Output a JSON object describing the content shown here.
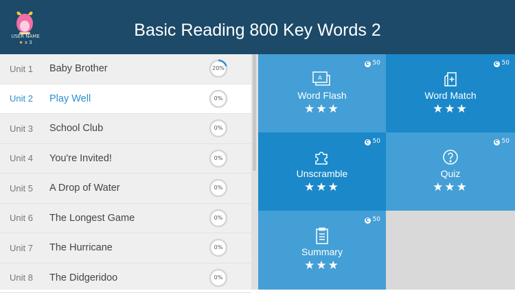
{
  "header": {
    "title": "Basic Reading 800 Key Words 2",
    "user_name": "USER NAME",
    "star_count": "x 3"
  },
  "units": [
    {
      "unit": "Unit 1",
      "name": "Baby Brother",
      "progress": "20%",
      "pct": 20
    },
    {
      "unit": "Unit 2",
      "name": "Play Well",
      "progress": "0%",
      "pct": 0,
      "selected": true
    },
    {
      "unit": "Unit 3",
      "name": "School Club",
      "progress": "0%",
      "pct": 0
    },
    {
      "unit": "Unit 4",
      "name": "You're Invited!",
      "progress": "0%",
      "pct": 0
    },
    {
      "unit": "Unit 5",
      "name": "A Drop of Water",
      "progress": "0%",
      "pct": 0
    },
    {
      "unit": "Unit 6",
      "name": "The Longest Game",
      "progress": "0%",
      "pct": 0
    },
    {
      "unit": "Unit 7",
      "name": "The Hurricane",
      "progress": "0%",
      "pct": 0
    },
    {
      "unit": "Unit 8",
      "name": "The Didgeridoo",
      "progress": "0%",
      "pct": 0
    }
  ],
  "activities": [
    {
      "label": "Word Flash",
      "coins": "50",
      "icon": "flashcard-icon",
      "stars": 3
    },
    {
      "label": "Word Match",
      "coins": "50",
      "icon": "card-match-icon",
      "stars": 3
    },
    {
      "label": "Unscramble",
      "coins": "50",
      "icon": "puzzle-icon",
      "stars": 3
    },
    {
      "label": "Quiz",
      "coins": "50",
      "icon": "question-icon",
      "stars": 3
    },
    {
      "label": "Summary",
      "coins": "50",
      "icon": "document-icon",
      "stars": 3
    }
  ],
  "colors": {
    "header": "#1c4a68",
    "tile_light": "#439fd6",
    "tile_dark": "#1a88c9",
    "accent": "#2a90cf"
  }
}
